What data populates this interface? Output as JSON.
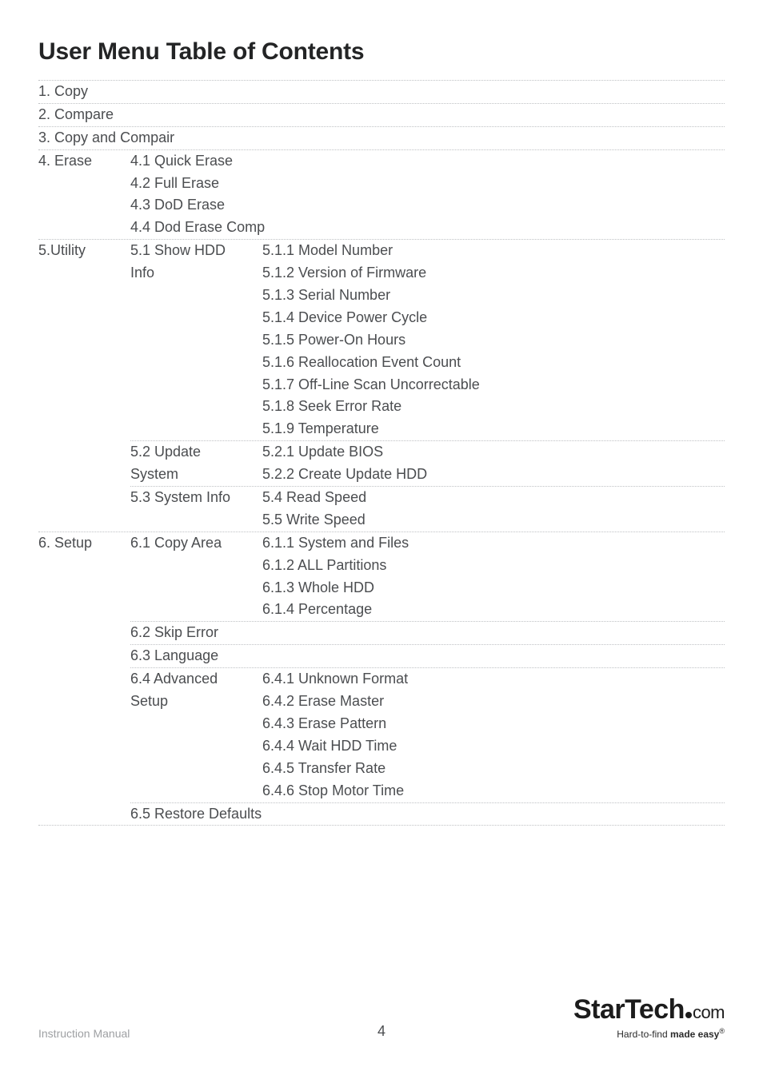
{
  "title": "User Menu Table of Contents",
  "s1": "1. Copy",
  "s2": "2. Compare",
  "s3": "3. Copy and Compair",
  "s4": {
    "label": "4. Erase",
    "i1": "4.1 Quick Erase",
    "i2": "4.2 Full Erase",
    "i3": "4.3 DoD Erase",
    "i4": "4.4 Dod Erase Comp"
  },
  "s5": {
    "label": "5.Utility",
    "g1": {
      "label": "5.1 Show HDD Info",
      "label_a": "5.1 Show HDD",
      "label_b": "Info",
      "i1": "5.1.1 Model Number",
      "i2": "5.1.2 Version of Firmware",
      "i3": "5.1.3 Serial Number",
      "i4": "5.1.4 Device Power Cycle",
      "i5": "5.1.5 Power-On Hours",
      "i6": "5.1.6 Reallocation Event Count",
      "i7": "5.1.7 Off-Line Scan Uncorrectable",
      "i8": "5.1.8 Seek Error Rate",
      "i9": "5.1.9 Temperature"
    },
    "g2": {
      "label_a": "5.2 Update",
      "label_b": "System",
      "i1": "5.2.1 Update BIOS",
      "i2": "5.2.2 Create Update HDD"
    },
    "g3": {
      "label": "5.3 System Info",
      "i1": "5.4 Read Speed",
      "i2": "5.5 Write Speed"
    }
  },
  "s6": {
    "label": "6. Setup",
    "g1": {
      "label": "6.1 Copy Area",
      "i1": "6.1.1 System and Files",
      "i2": "6.1.2 ALL Partitions",
      "i3": "6.1.3 Whole HDD",
      "i4": "6.1.4 Percentage"
    },
    "g2": "6.2 Skip Error",
    "g3": "6.3 Language",
    "g4": {
      "label_a": "6.4 Advanced",
      "label_b": "Setup",
      "i1": "6.4.1 Unknown Format",
      "i2": "6.4.2 Erase Master",
      "i3": "6.4.3 Erase Pattern",
      "i4": "6.4.4 Wait HDD Time",
      "i5": "6.4.5 Transfer Rate",
      "i6": "6.4.6 Stop Motor Time"
    },
    "g5": "6.5 Restore Defaults"
  },
  "footer": {
    "manual": "Instruction Manual",
    "page": "4",
    "logo_main": "StarTech",
    "logo_com": "com",
    "logo_tag_a": "Hard-to-find ",
    "logo_tag_b": "made easy",
    "reg": "®"
  }
}
